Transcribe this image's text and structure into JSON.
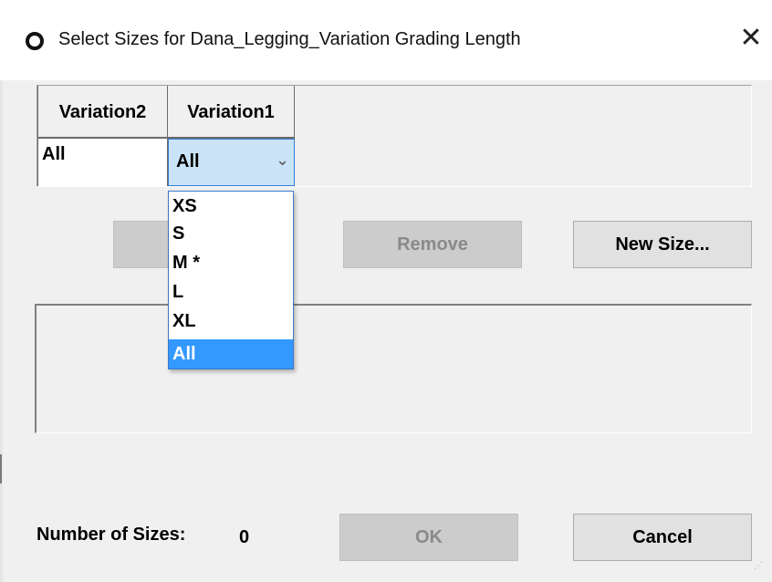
{
  "window": {
    "title": "Select Sizes for Dana_Legging_Variation Grading Length",
    "app_icon": "circle-ring-icon",
    "close_icon": "close-icon"
  },
  "grid": {
    "columns": [
      "Variation2",
      "Variation1"
    ],
    "values": [
      "All",
      "All"
    ],
    "dropdown_icon": "chevron-down-icon"
  },
  "dropdown": {
    "options": [
      "XS",
      "S",
      "M *",
      "L",
      "XL",
      "All"
    ],
    "highlighted": "All"
  },
  "buttons": {
    "add": "",
    "remove": "Remove",
    "new_size": "New Size...",
    "ok": "OK",
    "cancel": "Cancel"
  },
  "footer": {
    "count_label": "Number of Sizes:",
    "count_value": "0"
  },
  "colors": {
    "selection": "#3399ff",
    "combo_focus": "#cce4f7",
    "disabled_text": "#8a8a8a"
  }
}
